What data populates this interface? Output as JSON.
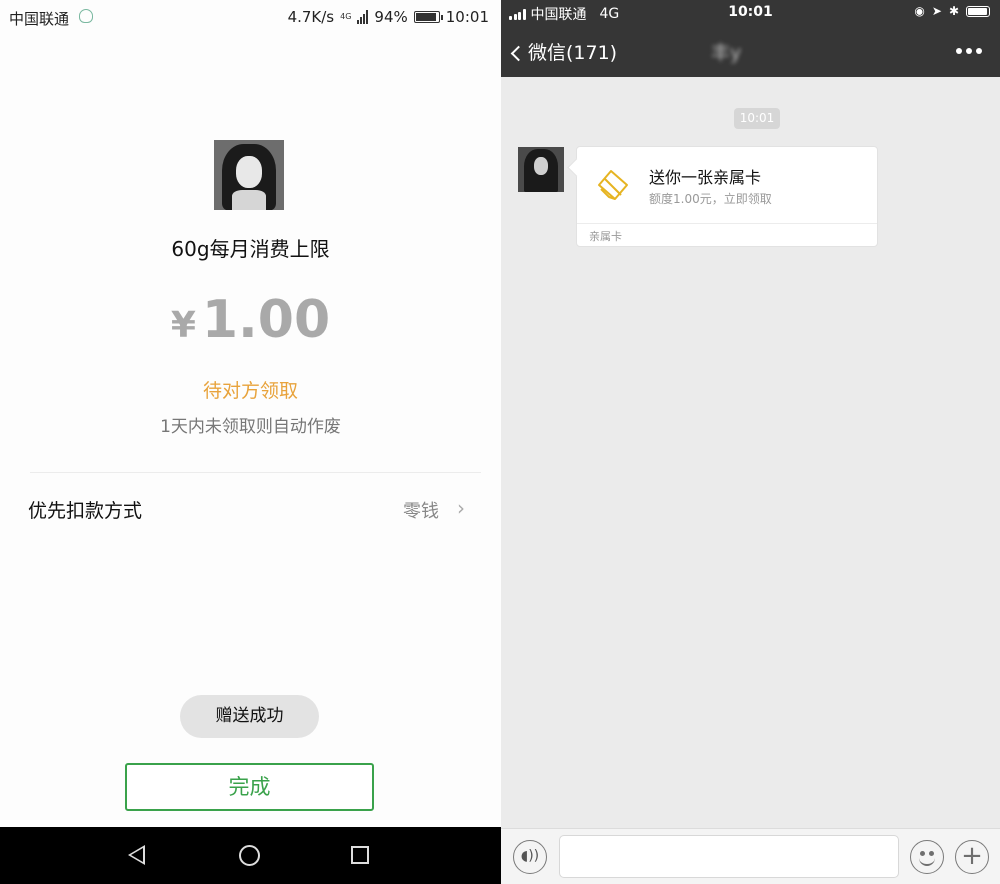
{
  "android": {
    "status": {
      "carrier": "中国联通",
      "speed": "4.7K/s",
      "network": "4G",
      "battery": "94%",
      "time": "10:01"
    },
    "card_title": "60g每月消费上限",
    "amount_symbol": "¥",
    "amount": "1.00",
    "status_text": "待对方领取",
    "expire_text": "1天内未领取则自动作废",
    "payment": {
      "label": "优先扣款方式",
      "value": "零钱"
    },
    "toast": "赠送成功",
    "done_button": "完成"
  },
  "ios": {
    "status": {
      "carrier": "中国联通",
      "network": "4G",
      "time": "10:01"
    },
    "nav": {
      "back_label": "微信(171)",
      "chat_name": "丰y"
    },
    "timestamp": "10:01",
    "card": {
      "title": "送你一张亲属卡",
      "subtitle": "额度1.00元，立即领取",
      "footer": "亲属卡"
    }
  },
  "colors": {
    "wechat_green": "#3aa24b",
    "pending_orange": "#e8a33c",
    "ios_header": "#363636",
    "chat_bg": "#ebebeb",
    "card_icon_gold": "#e6b422"
  }
}
